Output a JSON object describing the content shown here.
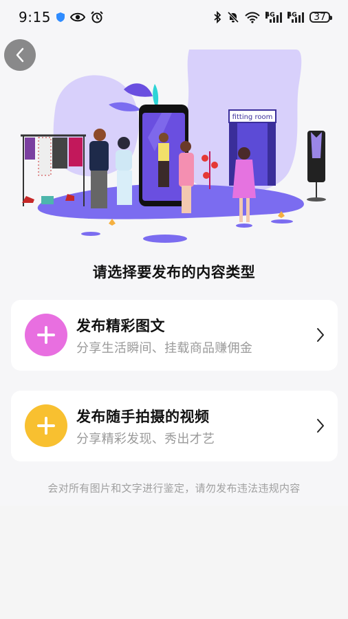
{
  "status_bar": {
    "time": "9:15",
    "battery": "37",
    "signal1_label": "4G",
    "signal2_label": "4G",
    "icons": [
      "shield-icon",
      "eye-icon",
      "alarm-icon",
      "bluetooth-icon",
      "bell-off-icon",
      "wifi-icon",
      "signal-icon",
      "signal-icon",
      "battery-icon"
    ]
  },
  "navigation": {
    "back_icon": "chevron-left-icon"
  },
  "illustration": {
    "fitting_room_sign": "fitting room"
  },
  "prompt": {
    "title": "请选择要发布的内容类型"
  },
  "options": [
    {
      "title": "发布精彩图文",
      "subtitle": "分享生活瞬间、挂载商品赚佣金",
      "icon": "plus-icon",
      "color": "#e86fe0"
    },
    {
      "title": "发布随手拍摄的视频",
      "subtitle": "分享精彩发现、秀出才艺",
      "icon": "plus-icon",
      "color": "#f8c030"
    }
  ],
  "footer": {
    "disclaimer": "会对所有图片和文字进行鉴定，请勿发布违法违规内容"
  },
  "colors": {
    "accent_purple": "#7b6cf0",
    "light_purple": "#d8d0fb",
    "background": "#f6f6f8"
  }
}
